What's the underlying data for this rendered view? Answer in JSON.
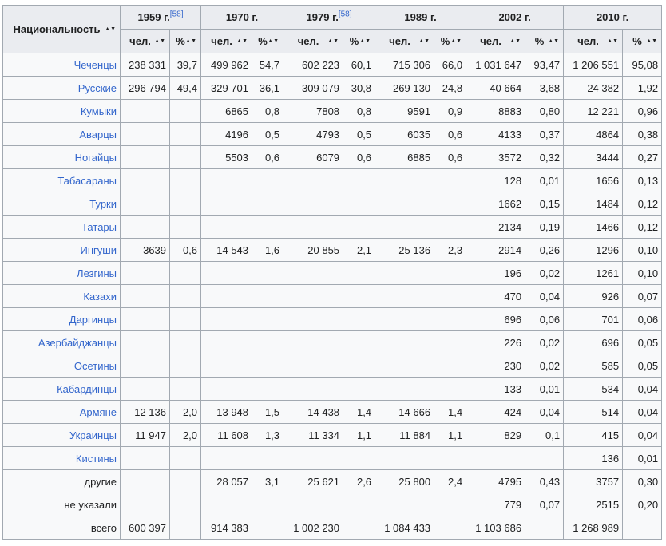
{
  "header": {
    "nationality": "Национальность",
    "years": [
      {
        "label": "1959 г.",
        "ref": "[58]"
      },
      {
        "label": "1970 г.",
        "ref": ""
      },
      {
        "label": "1979 г.",
        "ref": "[58]"
      },
      {
        "label": "1989 г.",
        "ref": ""
      },
      {
        "label": "2002 г.",
        "ref": ""
      },
      {
        "label": "2010 г.",
        "ref": ""
      }
    ],
    "sub_people": "чел.",
    "sub_percent": "%"
  },
  "rows": [
    {
      "name": "Чеченцы",
      "link": true,
      "v": [
        "238 331",
        "39,7",
        "499 962",
        "54,7",
        "602 223",
        "60,1",
        "715 306",
        "66,0",
        "1 031 647",
        "93,47",
        "1 206 551",
        "95,08"
      ]
    },
    {
      "name": "Русские",
      "link": true,
      "v": [
        "296 794",
        "49,4",
        "329 701",
        "36,1",
        "309 079",
        "30,8",
        "269 130",
        "24,8",
        "40 664",
        "3,68",
        "24 382",
        "1,92"
      ]
    },
    {
      "name": "Кумыки",
      "link": true,
      "v": [
        "",
        "",
        "6865",
        "0,8",
        "7808",
        "0,8",
        "9591",
        "0,9",
        "8883",
        "0,80",
        "12 221",
        "0,96"
      ]
    },
    {
      "name": "Аварцы",
      "link": true,
      "v": [
        "",
        "",
        "4196",
        "0,5",
        "4793",
        "0,5",
        "6035",
        "0,6",
        "4133",
        "0,37",
        "4864",
        "0,38"
      ]
    },
    {
      "name": "Ногайцы",
      "link": true,
      "v": [
        "",
        "",
        "5503",
        "0,6",
        "6079",
        "0,6",
        "6885",
        "0,6",
        "3572",
        "0,32",
        "3444",
        "0,27"
      ]
    },
    {
      "name": "Табасараны",
      "link": true,
      "v": [
        "",
        "",
        "",
        "",
        "",
        "",
        "",
        "",
        "128",
        "0,01",
        "1656",
        "0,13"
      ]
    },
    {
      "name": "Турки",
      "link": true,
      "v": [
        "",
        "",
        "",
        "",
        "",
        "",
        "",
        "",
        "1662",
        "0,15",
        "1484",
        "0,12"
      ]
    },
    {
      "name": "Татары",
      "link": true,
      "v": [
        "",
        "",
        "",
        "",
        "",
        "",
        "",
        "",
        "2134",
        "0,19",
        "1466",
        "0,12"
      ]
    },
    {
      "name": "Ингуши",
      "link": true,
      "v": [
        "3639",
        "0,6",
        "14 543",
        "1,6",
        "20 855",
        "2,1",
        "25 136",
        "2,3",
        "2914",
        "0,26",
        "1296",
        "0,10"
      ]
    },
    {
      "name": "Лезгины",
      "link": true,
      "v": [
        "",
        "",
        "",
        "",
        "",
        "",
        "",
        "",
        "196",
        "0,02",
        "1261",
        "0,10"
      ]
    },
    {
      "name": "Казахи",
      "link": true,
      "v": [
        "",
        "",
        "",
        "",
        "",
        "",
        "",
        "",
        "470",
        "0,04",
        "926",
        "0,07"
      ]
    },
    {
      "name": "Даргинцы",
      "link": true,
      "v": [
        "",
        "",
        "",
        "",
        "",
        "",
        "",
        "",
        "696",
        "0,06",
        "701",
        "0,06"
      ]
    },
    {
      "name": "Азербайджанцы",
      "link": true,
      "v": [
        "",
        "",
        "",
        "",
        "",
        "",
        "",
        "",
        "226",
        "0,02",
        "696",
        "0,05"
      ]
    },
    {
      "name": "Осетины",
      "link": true,
      "v": [
        "",
        "",
        "",
        "",
        "",
        "",
        "",
        "",
        "230",
        "0,02",
        "585",
        "0,05"
      ]
    },
    {
      "name": "Кабардинцы",
      "link": true,
      "v": [
        "",
        "",
        "",
        "",
        "",
        "",
        "",
        "",
        "133",
        "0,01",
        "534",
        "0,04"
      ]
    },
    {
      "name": "Армяне",
      "link": true,
      "v": [
        "12 136",
        "2,0",
        "13 948",
        "1,5",
        "14 438",
        "1,4",
        "14 666",
        "1,4",
        "424",
        "0,04",
        "514",
        "0,04"
      ]
    },
    {
      "name": "Украинцы",
      "link": true,
      "v": [
        "11 947",
        "2,0",
        "11 608",
        "1,3",
        "11 334",
        "1,1",
        "11 884",
        "1,1",
        "829",
        "0,1",
        "415",
        "0,04"
      ]
    },
    {
      "name": "Кистины",
      "link": true,
      "v": [
        "",
        "",
        "",
        "",
        "",
        "",
        "",
        "",
        "",
        "",
        "136",
        "0,01"
      ]
    },
    {
      "name": "другие",
      "link": false,
      "v": [
        "",
        "",
        "28 057",
        "3,1",
        "25 621",
        "2,6",
        "25 800",
        "2,4",
        "4795",
        "0,43",
        "3757",
        "0,30"
      ]
    },
    {
      "name": "не указали",
      "link": false,
      "v": [
        "",
        "",
        "",
        "",
        "",
        "",
        "",
        "",
        "779",
        "0,07",
        "2515",
        "0,20"
      ]
    },
    {
      "name": "всего",
      "link": false,
      "v": [
        "600 397",
        "",
        "914 383",
        "",
        "1 002 230",
        "",
        "1 084 433",
        "",
        "1 103 686",
        "",
        "1 268 989",
        ""
      ]
    }
  ]
}
